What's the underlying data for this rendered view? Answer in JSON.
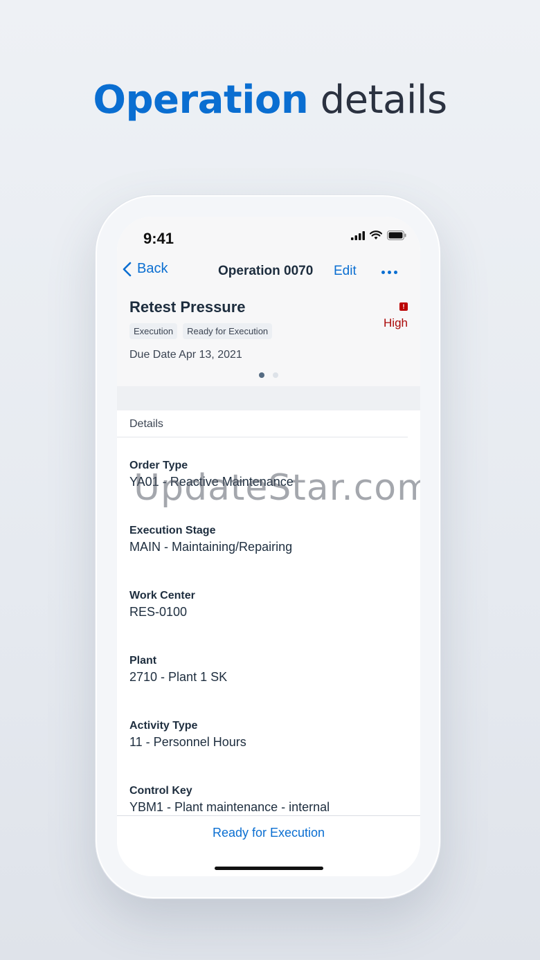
{
  "headline": {
    "accent": "Operation",
    "rest": "details"
  },
  "status_bar": {
    "time": "9:41"
  },
  "nav": {
    "back_label": "Back",
    "title": "Operation 0070",
    "edit_label": "Edit"
  },
  "header": {
    "title": "Retest Pressure",
    "tags": [
      "Execution",
      "Ready for Execution"
    ],
    "priority_label": "High",
    "priority_icon": "!",
    "due": "Due Date Apr 13, 2021"
  },
  "details": {
    "section_label": "Details",
    "fields": [
      {
        "label": "Order Type",
        "value": "YA01 - Reactive Maintenance"
      },
      {
        "label": "Execution Stage",
        "value": "MAIN - Maintaining/Repairing"
      },
      {
        "label": "Work Center",
        "value": "RES-0100"
      },
      {
        "label": "Plant",
        "value": "2710 - Plant 1 SK"
      },
      {
        "label": "Activity Type",
        "value": "11 - Personnel Hours"
      },
      {
        "label": "Control Key",
        "value": "YBM1 - Plant maintenance - internal"
      }
    ]
  },
  "footer": {
    "action_label": "Ready for Execution"
  },
  "watermark": "UpdateStar.com",
  "colors": {
    "accent": "#0a6ed1",
    "priority": "#aa0808",
    "text": "#1d2d3e"
  }
}
